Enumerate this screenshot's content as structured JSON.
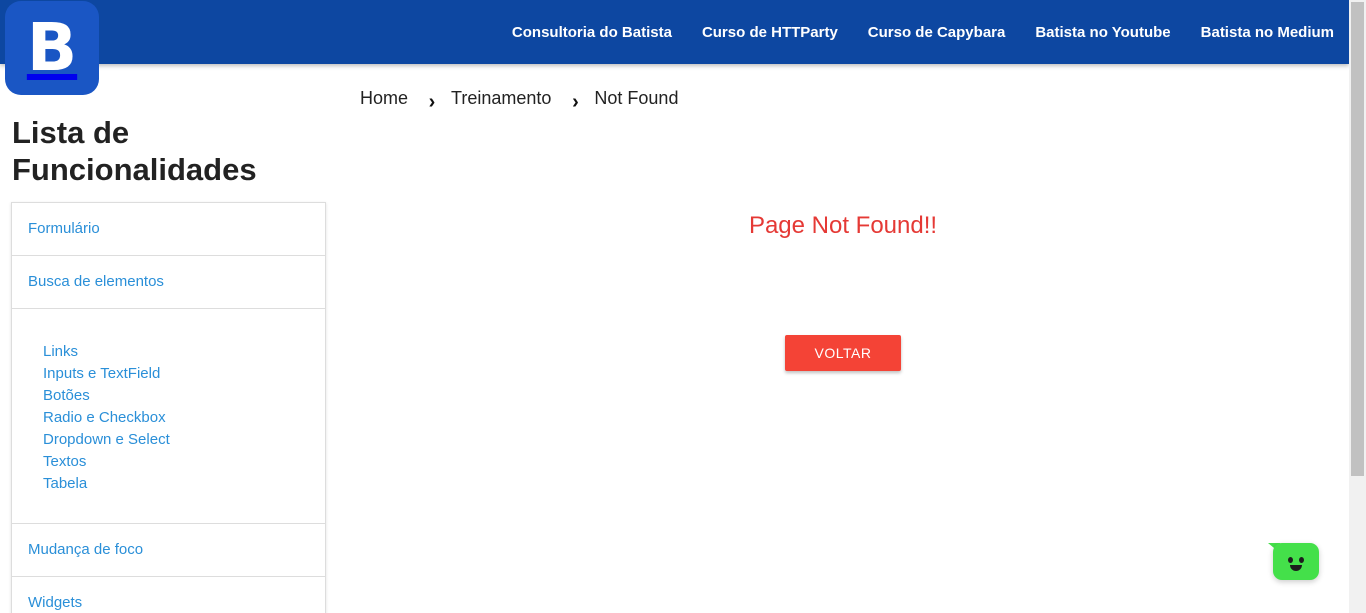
{
  "header": {
    "logo_letter": "B",
    "nav": [
      {
        "label": "Consultoria do Batista"
      },
      {
        "label": "Curso de HTTParty"
      },
      {
        "label": "Curso de Capybara"
      },
      {
        "label": "Batista no Youtube"
      },
      {
        "label": "Batista no Medium"
      }
    ],
    "background_color": "#0d47a1"
  },
  "sidebar": {
    "title": "Lista de Funcionalidades",
    "sections": {
      "formulario": "Formulário",
      "busca": "Busca de elementos",
      "busca_items": [
        "Links",
        "Inputs e TextField",
        "Botões",
        "Radio e Checkbox",
        "Dropdown e Select",
        "Textos",
        "Tabela"
      ],
      "mudanca_foco": "Mudança de foco",
      "widgets": "Widgets"
    },
    "link_color": "#2a8fd8"
  },
  "breadcrumb": {
    "items": [
      "Home",
      "Treinamento",
      "Not Found"
    ],
    "separator_icon": "chevron-right-icon"
  },
  "main": {
    "error_message": "Page Not Found!!",
    "error_color": "#e53935",
    "back_button": "VOLTAR",
    "button_color": "#f44336"
  },
  "chat_widget": {
    "icon": "chat-smiley-icon",
    "color": "#44e04a"
  }
}
